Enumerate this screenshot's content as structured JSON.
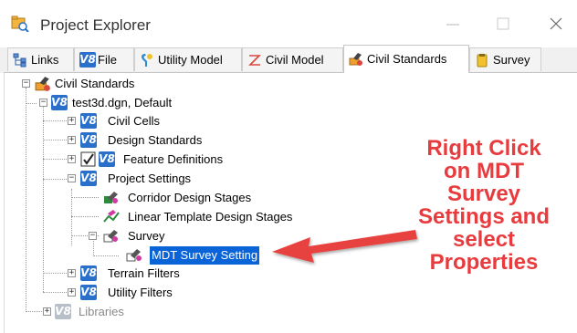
{
  "window": {
    "title": "Project Explorer",
    "icon": "project-explorer-icon"
  },
  "tabs": [
    {
      "label": "Links",
      "icon": "links-icon"
    },
    {
      "label": "File",
      "icon": "v8-icon"
    },
    {
      "label": "Utility Model",
      "icon": "utility-model-icon"
    },
    {
      "label": "Civil Model",
      "icon": "civil-model-icon"
    },
    {
      "label": "Civil Standards",
      "icon": "civil-standards-icon",
      "active": true
    },
    {
      "label": "Survey",
      "icon": "survey-icon"
    }
  ],
  "tree": {
    "root": "Civil Standards",
    "file": "test3d.dgn, Default",
    "civil_cells": "Civil Cells",
    "design_standards": "Design Standards",
    "feature_definitions": "Feature Definitions",
    "project_settings": "Project Settings",
    "corridor_design_stages": "Corridor Design Stages",
    "linear_template_design_stages": "Linear Template Design Stages",
    "survey": "Survey",
    "mdt_survey_setting": "MDT Survey Setting",
    "terrain_filters": "Terrain Filters",
    "utility_filters": "Utility Filters",
    "libraries": "Libraries",
    "v8_badge": "V8"
  },
  "annotation": {
    "lines": [
      "Right Click",
      "on MDT",
      "Survey",
      "Settings and",
      "select",
      "Properties"
    ],
    "color": "#e83b3e"
  },
  "colors": {
    "selection": "#0a64d7",
    "v8_blue": "#2a6fc9"
  }
}
